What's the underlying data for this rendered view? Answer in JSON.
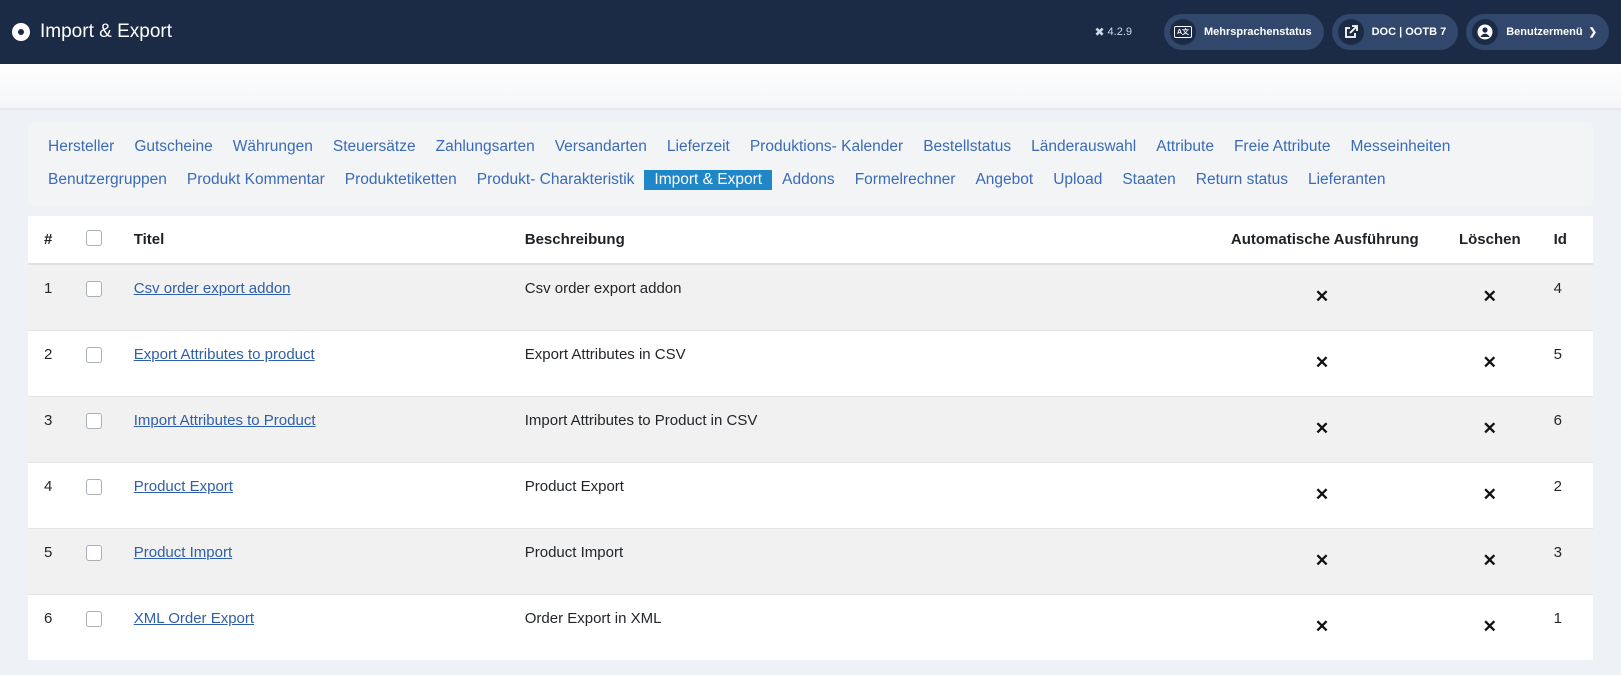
{
  "header": {
    "title": "Import & Export",
    "version": "4.2.9",
    "buttons": [
      {
        "label": "Mehrsprachenstatus",
        "icon": "language-icon"
      },
      {
        "label": "DOC | OOTB 7",
        "icon": "external-link-icon"
      },
      {
        "label": "Benutzermenü",
        "icon": "user-icon"
      }
    ]
  },
  "tabs_row1": [
    "Hersteller",
    "Gutscheine",
    "Währungen",
    "Steuersätze",
    "Zahlungsarten",
    "Versandarten",
    "Lieferzeit",
    "Produktions- Kalender",
    "Bestellstatus",
    "Länderauswahl",
    "Attribute",
    "Freie Attribute",
    "Messeinheiten"
  ],
  "tabs_row2": [
    "Benutzergruppen",
    "Produkt Kommentar",
    "Produktetiketten",
    "Produkt- Charakteristik",
    "Import & Export",
    "Addons",
    "Formelrechner",
    "Angebot",
    "Upload",
    "Staaten",
    "Return status",
    "Lieferanten"
  ],
  "active_tab": "Import & Export",
  "table": {
    "headers": {
      "num": "#",
      "title": "Titel",
      "description": "Beschreibung",
      "auto": "Automatische Ausführung",
      "delete": "Löschen",
      "id": "Id"
    },
    "rows": [
      {
        "num": "1",
        "title": "Csv order export addon",
        "description": "Csv order export addon",
        "auto": "✕",
        "delete": "✕",
        "id": "4"
      },
      {
        "num": "2",
        "title": "Export Attributes to product",
        "description": "Export Attributes in CSV",
        "auto": "✕",
        "delete": "✕",
        "id": "5"
      },
      {
        "num": "3",
        "title": "Import Attributes to Product",
        "description": "Import Attributes to Product in CSV",
        "auto": "✕",
        "delete": "✕",
        "id": "6"
      },
      {
        "num": "4",
        "title": "Product Export",
        "description": "Product Export",
        "auto": "✕",
        "delete": "✕",
        "id": "2"
      },
      {
        "num": "5",
        "title": "Product Import",
        "description": "Product Import",
        "auto": "✕",
        "delete": "✕",
        "id": "3"
      },
      {
        "num": "6",
        "title": "XML Order Export",
        "description": "Order Export in XML",
        "auto": "✕",
        "delete": "✕",
        "id": "1"
      }
    ]
  }
}
